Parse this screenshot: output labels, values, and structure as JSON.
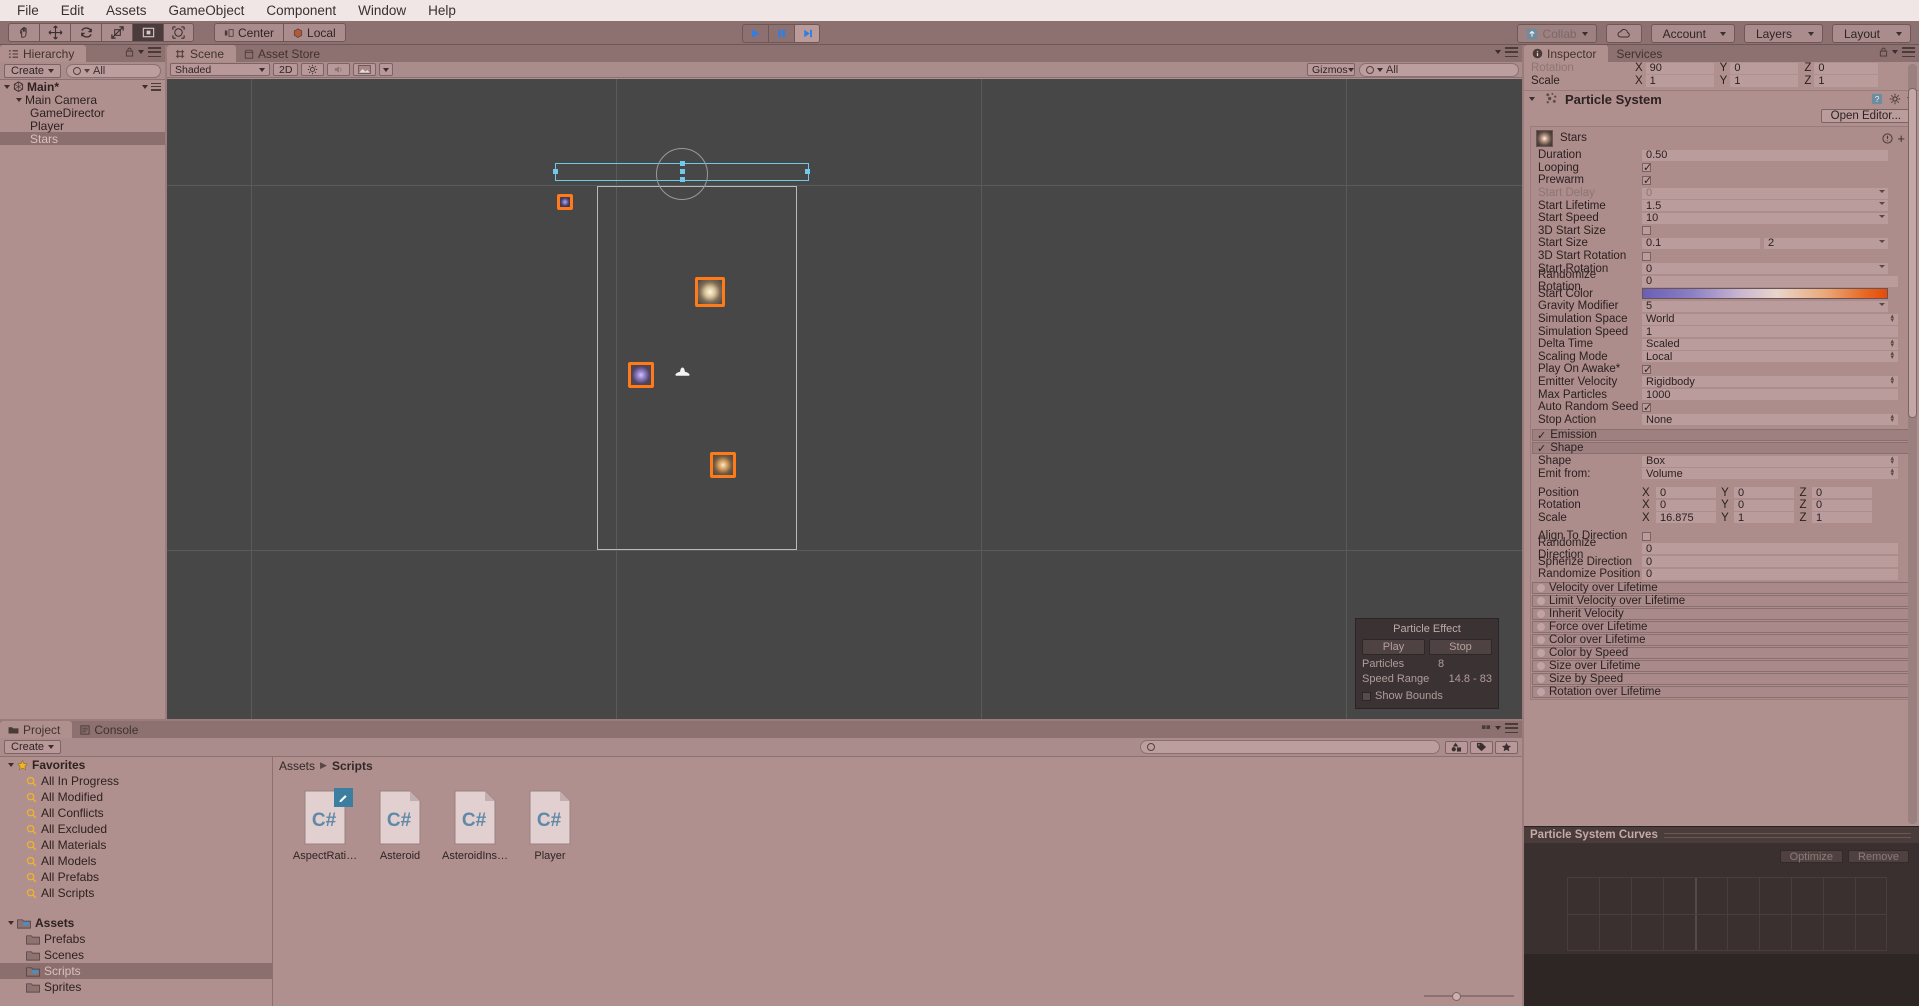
{
  "menubar": {
    "items": [
      "File",
      "Edit",
      "Assets",
      "GameObject",
      "Component",
      "Window",
      "Help"
    ]
  },
  "toolbar": {
    "tools": [
      {
        "name": "hand-tool",
        "icon": "hand"
      },
      {
        "name": "move-tool",
        "icon": "move"
      },
      {
        "name": "rotate-tool",
        "icon": "rotate"
      },
      {
        "name": "scale-tool",
        "icon": "scale"
      },
      {
        "name": "rect-tool",
        "icon": "rect"
      },
      {
        "name": "transform-tool",
        "icon": "transform"
      }
    ],
    "pivot_label": "Center",
    "space_label": "Local",
    "play_label": "play",
    "pause_label": "pause",
    "step_label": "step",
    "collab_label": "Collab",
    "cloud_label": "cloud",
    "account_label": "Account",
    "layers_label": "Layers",
    "layout_label": "Layout"
  },
  "hierarchy": {
    "tab": "Hierarchy",
    "create_label": "Create",
    "search_placeholder": "All",
    "scene_name": "Main*",
    "items": [
      {
        "label": "Main Camera",
        "depth": 1,
        "expandable": true,
        "selected": false
      },
      {
        "label": "GameDirector",
        "depth": 2,
        "expandable": false,
        "selected": false
      },
      {
        "label": "Player",
        "depth": 2,
        "expandable": false,
        "selected": false
      },
      {
        "label": "Stars",
        "depth": 2,
        "expandable": false,
        "selected": true
      }
    ]
  },
  "scene": {
    "tabs": [
      {
        "label": "Scene",
        "icon": "grid-icon",
        "selected": true
      },
      {
        "label": "Asset Store",
        "icon": "store-icon",
        "selected": false
      }
    ],
    "draw_mode": "Shaded",
    "mode_2d": "2D",
    "lighting_icon": "sun-icon",
    "audio_icon": "speaker-icon",
    "effects_icon": "image-icon",
    "gizmos_label": "Gizmos",
    "search_placeholder": "All",
    "particle_effect": {
      "title": "Particle Effect",
      "play_label": "Play",
      "stop_label": "Stop",
      "particles_label": "Particles",
      "particles_value": "8",
      "speed_label": "Speed Range",
      "speed_value": "14.8 - 83",
      "show_bounds_label": "Show Bounds",
      "show_bounds_checked": false
    }
  },
  "project": {
    "tabs": [
      {
        "label": "Project",
        "icon": "folder-icon",
        "selected": true
      },
      {
        "label": "Console",
        "icon": "console-icon",
        "selected": false
      }
    ],
    "create_label": "Create",
    "favorites_label": "Favorites",
    "favorites": [
      "All In Progress",
      "All Modified",
      "All Conflicts",
      "All Excluded",
      "All Materials",
      "All Models",
      "All Prefabs",
      "All Scripts"
    ],
    "assets_label": "Assets",
    "folders": [
      {
        "label": "Prefabs",
        "selected": false
      },
      {
        "label": "Scenes",
        "selected": false
      },
      {
        "label": "Scripts",
        "selected": true
      },
      {
        "label": "Sprites",
        "selected": false
      }
    ],
    "breadcrumb": [
      "Assets",
      "Scripts"
    ],
    "assets": [
      {
        "label": "AspectRati…",
        "type": "C#",
        "badge": "edit"
      },
      {
        "label": "Asteroid",
        "type": "C#",
        "badge": null
      },
      {
        "label": "AsteroidIns…",
        "type": "C#",
        "badge": null
      },
      {
        "label": "Player",
        "type": "C#",
        "badge": null
      }
    ]
  },
  "inspector": {
    "tabs": [
      {
        "label": "Inspector",
        "icon": "info-icon",
        "selected": true
      },
      {
        "label": "Services",
        "icon": "services-icon",
        "selected": false
      }
    ],
    "lock_icon": "lock-icon",
    "transform_partial": [
      {
        "label": "Rotation",
        "x": "90",
        "y": "0",
        "z": "0"
      },
      {
        "label": "Scale",
        "x": "1",
        "y": "1",
        "z": "1"
      }
    ],
    "component_title": "Particle System",
    "open_editor_label": "Open Editor...",
    "system_name": "Stars",
    "main_props": [
      {
        "label": "Duration",
        "value": "0.50",
        "type": "text"
      },
      {
        "label": "Looping",
        "value": true,
        "type": "check"
      },
      {
        "label": "Prewarm",
        "value": true,
        "type": "check"
      },
      {
        "label": "Start Delay",
        "value": "0",
        "type": "text",
        "dim": true,
        "dropdown": true
      },
      {
        "label": "Start Lifetime",
        "value": "1.5",
        "type": "text",
        "dropdown": true
      },
      {
        "label": "Start Speed",
        "value": "10",
        "type": "text",
        "dropdown": true
      },
      {
        "label": "3D Start Size",
        "value": false,
        "type": "check"
      },
      {
        "label": "Start Size",
        "value": "0.1",
        "value2": "2",
        "type": "dual",
        "dropdown": true
      },
      {
        "label": "3D Start Rotation",
        "value": false,
        "type": "check"
      },
      {
        "label": "Start Rotation",
        "value": "0",
        "type": "text",
        "dropdown": true
      },
      {
        "label": "Randomize Rotation",
        "value": "0",
        "type": "text"
      },
      {
        "label": "Start Color",
        "value": "",
        "type": "gradient",
        "dropdown": true
      },
      {
        "label": "Gravity Modifier",
        "value": "5",
        "type": "text",
        "dropdown": true
      },
      {
        "label": "Simulation Space",
        "value": "World",
        "type": "enum"
      },
      {
        "label": "Simulation Speed",
        "value": "1",
        "type": "text"
      },
      {
        "label": "Delta Time",
        "value": "Scaled",
        "type": "enum"
      },
      {
        "label": "Scaling Mode",
        "value": "Local",
        "type": "enum"
      },
      {
        "label": "Play On Awake*",
        "value": true,
        "type": "check"
      },
      {
        "label": "Emitter Velocity",
        "value": "Rigidbody",
        "type": "enum"
      },
      {
        "label": "Max Particles",
        "value": "1000",
        "type": "text"
      },
      {
        "label": "Auto Random Seed",
        "value": true,
        "type": "check"
      },
      {
        "label": "Stop Action",
        "value": "None",
        "type": "enum"
      }
    ],
    "emission_label": "Emission",
    "emission_checked": true,
    "shape_label": "Shape",
    "shape_checked": true,
    "shape_props": [
      {
        "label": "Shape",
        "value": "Box",
        "type": "enum"
      },
      {
        "label": "Emit from:",
        "value": "Volume",
        "type": "enum"
      }
    ],
    "shape_vectors": [
      {
        "label": "Position",
        "x": "0",
        "y": "0",
        "z": "0"
      },
      {
        "label": "Rotation",
        "x": "0",
        "y": "0",
        "z": "0"
      },
      {
        "label": "Scale",
        "x": "16.875",
        "y": "1",
        "z": "1"
      }
    ],
    "shape_extra": [
      {
        "label": "Align To Direction",
        "value": false,
        "type": "check"
      },
      {
        "label": "Randomize Direction",
        "value": "0",
        "type": "text"
      },
      {
        "label": "Spherize Direction",
        "value": "0",
        "type": "text"
      },
      {
        "label": "Randomize Position",
        "value": "0",
        "type": "text"
      }
    ],
    "modules": [
      "Velocity over Lifetime",
      "Limit Velocity over Lifetime",
      "Inherit Velocity",
      "Force over Lifetime",
      "Color over Lifetime",
      "Color by Speed",
      "Size over Lifetime",
      "Size by Speed",
      "Rotation over Lifetime"
    ],
    "curves_title": "Particle System Curves",
    "optimize_label": "Optimize",
    "remove_label": "Remove",
    "gradient_colors": [
      "#6a5fb5",
      "#8b7fc4",
      "#c9b7d0",
      "#e9d5cb",
      "#eaa878",
      "#e8641f",
      "#e44c0a"
    ]
  }
}
